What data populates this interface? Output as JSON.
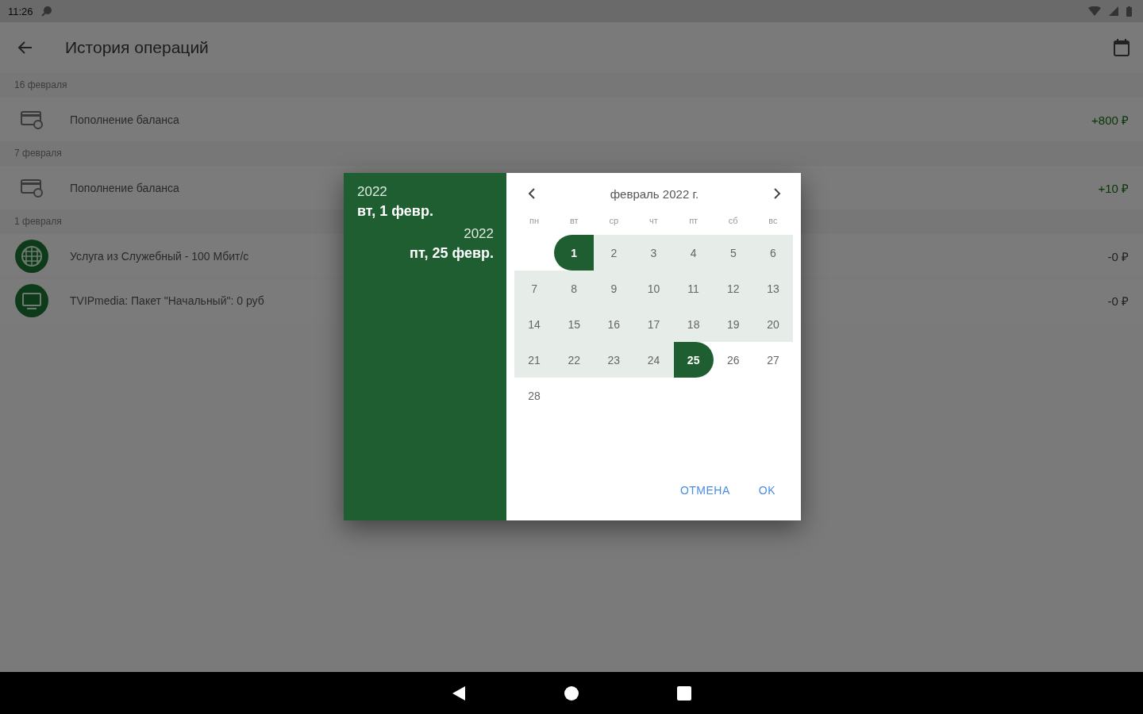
{
  "status_bar": {
    "time": "11:26"
  },
  "app_bar": {
    "title": "История операций"
  },
  "groups": [
    {
      "date": "16 февраля",
      "items": [
        {
          "kind": "card",
          "title": "Пополнение баланса",
          "amount": "+800 ₽",
          "credit": true
        }
      ]
    },
    {
      "date": "7 февраля",
      "items": [
        {
          "kind": "card",
          "title": "Пополнение баланса",
          "amount": "+10 ₽",
          "credit": true
        }
      ]
    },
    {
      "date": "1 февраля",
      "items": [
        {
          "kind": "globe",
          "title": "Услуга из Служебный - 100 Мбит/с",
          "amount": "-0 ₽",
          "credit": false
        },
        {
          "kind": "tv",
          "title": "TVIPmedia: Пакет \"Начальный\": 0 руб",
          "amount": "-0 ₽",
          "credit": false
        }
      ]
    }
  ],
  "date_range_dialog": {
    "start": {
      "year": "2022",
      "date": "вт, 1 февр."
    },
    "end": {
      "year": "2022",
      "date": "пт, 25 февр."
    },
    "month": "февраль 2022 г.",
    "weekdays": [
      "пн",
      "вт",
      "ср",
      "чт",
      "пт",
      "сб",
      "вс"
    ],
    "weeks": [
      [
        {
          "kind": "blank"
        },
        {
          "label": "1",
          "kind": "start"
        },
        {
          "label": "2",
          "kind": "middle"
        },
        {
          "label": "3",
          "kind": "middle"
        },
        {
          "label": "4",
          "kind": "middle"
        },
        {
          "label": "5",
          "kind": "middle"
        },
        {
          "label": "6",
          "kind": "middle"
        }
      ],
      [
        {
          "label": "7",
          "kind": "middle"
        },
        {
          "label": "8",
          "kind": "middle"
        },
        {
          "label": "9",
          "kind": "middle"
        },
        {
          "label": "10",
          "kind": "middle"
        },
        {
          "label": "11",
          "kind": "middle"
        },
        {
          "label": "12",
          "kind": "middle"
        },
        {
          "label": "13",
          "kind": "middle"
        }
      ],
      [
        {
          "label": "14",
          "kind": "middle"
        },
        {
          "label": "15",
          "kind": "middle"
        },
        {
          "label": "16",
          "kind": "middle"
        },
        {
          "label": "17",
          "kind": "middle"
        },
        {
          "label": "18",
          "kind": "middle"
        },
        {
          "label": "19",
          "kind": "middle"
        },
        {
          "label": "20",
          "kind": "middle"
        }
      ],
      [
        {
          "label": "21",
          "kind": "middle"
        },
        {
          "label": "22",
          "kind": "middle"
        },
        {
          "label": "23",
          "kind": "middle"
        },
        {
          "label": "24",
          "kind": "middle"
        },
        {
          "label": "25",
          "kind": "end"
        },
        {
          "label": "26",
          "kind": "plain"
        },
        {
          "label": "27",
          "kind": "plain"
        }
      ],
      [
        {
          "label": "28",
          "kind": "plain"
        }
      ]
    ],
    "buttons": [
      "ОТМЕНА",
      "OK"
    ]
  }
}
